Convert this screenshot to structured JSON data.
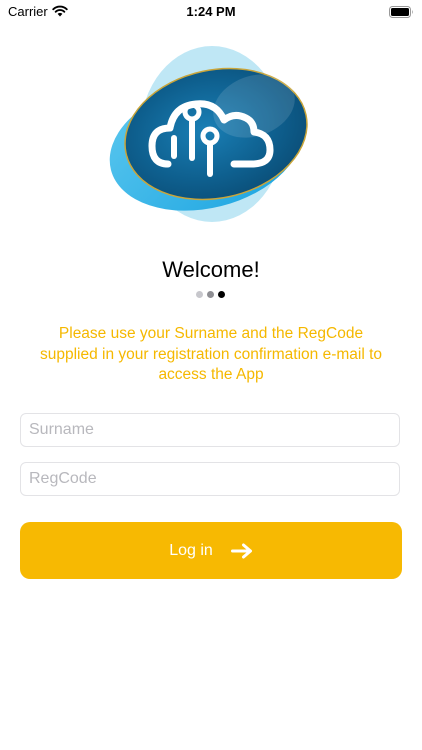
{
  "status_bar": {
    "carrier": "Carrier",
    "time": "1:24 PM"
  },
  "logo": {
    "icon": "cloud-circuit-icon",
    "colors": {
      "dark_blue": "#0e5f8e",
      "light_blue": "#3fb7e8",
      "pale_blue": "#a9dff2",
      "gold": "#c9a53a"
    }
  },
  "welcome": {
    "title": "Welcome!",
    "page_count": 3,
    "active_page": 3
  },
  "instructions": {
    "text": "Please use your Surname and the RegCode supplied in your registration confirmation e-mail to access the App"
  },
  "form": {
    "surname": {
      "placeholder": "Surname",
      "value": ""
    },
    "regcode": {
      "placeholder": "RegCode",
      "value": ""
    },
    "login_label": "Log in",
    "login_icon": "arrow-right-icon"
  },
  "colors": {
    "accent": "#f7b902",
    "instruction_text": "#f5b800"
  }
}
